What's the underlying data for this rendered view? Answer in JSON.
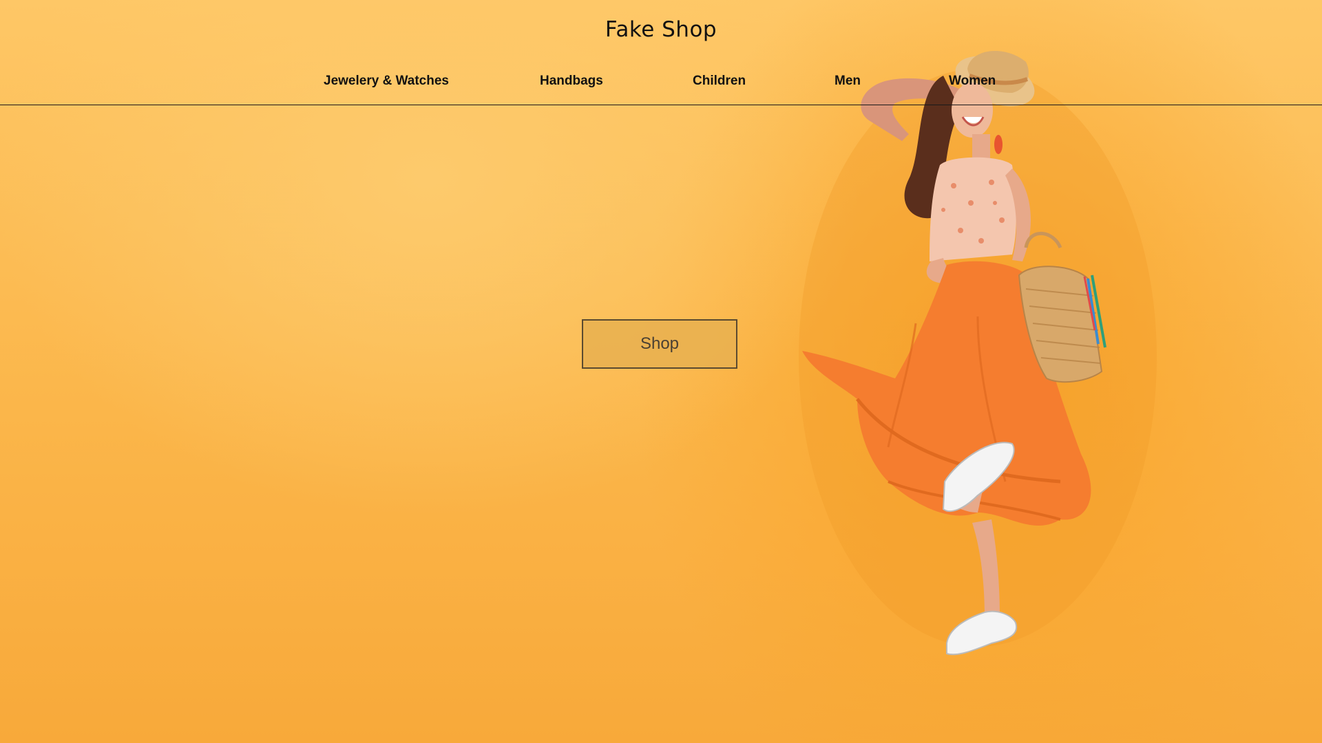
{
  "header": {
    "site_title": "Fake Shop"
  },
  "nav": {
    "items": [
      {
        "label": "Jewelery & Watches"
      },
      {
        "label": "Handbags"
      },
      {
        "label": "Children"
      },
      {
        "label": "Men"
      },
      {
        "label": "Women"
      }
    ]
  },
  "hero": {
    "cta_label": "Shop",
    "image_subject": "woman-in-orange-skirt-with-straw-hat-and-basket"
  },
  "colors": {
    "background": "#fbb64a",
    "button_fill": "#e8b050",
    "skirt": "#f57d2f"
  }
}
